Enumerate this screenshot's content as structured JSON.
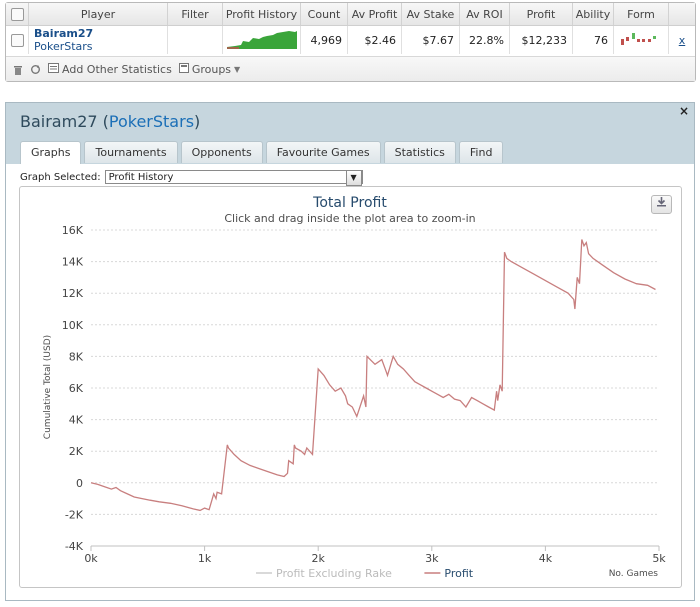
{
  "stats_table": {
    "headers": [
      "Player",
      "Filter",
      "Profit History",
      "Count",
      "Av Profit",
      "Av Stake",
      "Av ROI",
      "Profit",
      "Ability",
      "Form"
    ],
    "row": {
      "player_name": "Bairam27",
      "site": "PokerStars",
      "filter": "",
      "count": "4,969",
      "av_profit": "$2.46",
      "av_stake": "$7.67",
      "av_roi": "22.8%",
      "profit": "$12,233",
      "ability": "76",
      "remove": "x"
    },
    "toolbar": {
      "add_stats_label": "Add Other Statistics",
      "groups_label": "Groups"
    }
  },
  "panel": {
    "player_name": "Bairam27",
    "site": "PokerStars",
    "tabs": [
      "Graphs",
      "Tournaments",
      "Opponents",
      "Favourite Games",
      "Statistics",
      "Find"
    ],
    "active_tab": "Graphs",
    "graph_selected_label": "Graph Selected:",
    "graph_selected_value": "Profit History",
    "close_label": "×"
  },
  "chart_data": {
    "type": "line",
    "title": "Total Profit",
    "subtitle": "Click and drag inside the plot area to zoom-in",
    "ylabel": "Cumulative Total (USD)",
    "xlabel": "No. Games",
    "ylim": [
      -4000,
      16000
    ],
    "xlim": [
      0,
      5000
    ],
    "yticks": [
      "-4K",
      "-2K",
      "0",
      "2K",
      "4K",
      "6K",
      "8K",
      "10K",
      "12K",
      "14K",
      "16K"
    ],
    "xticks": [
      "0k",
      "1k",
      "2k",
      "3k",
      "4k",
      "5k"
    ],
    "grid": true,
    "legend_position": "bottom-center",
    "series": [
      {
        "name": "Profit Excluding Rake",
        "color": "#cccccc",
        "values": []
      },
      {
        "name": "Profit",
        "color": "#c87f7f",
        "x": [
          0,
          60,
          120,
          180,
          220,
          260,
          320,
          380,
          450,
          520,
          600,
          700,
          800,
          900,
          960,
          1000,
          1040,
          1080,
          1100,
          1110,
          1150,
          1200,
          1210,
          1260,
          1320,
          1400,
          1480,
          1560,
          1640,
          1700,
          1730,
          1740,
          1780,
          1790,
          1800,
          1850,
          1880,
          1900,
          1950,
          2000,
          2050,
          2100,
          2150,
          2200,
          2240,
          2260,
          2300,
          2340,
          2400,
          2420,
          2430,
          2500,
          2560,
          2600,
          2610,
          2660,
          2700,
          2750,
          2800,
          2850,
          2900,
          2950,
          3000,
          3050,
          3100,
          3150,
          3200,
          3250,
          3300,
          3350,
          3400,
          3450,
          3500,
          3550,
          3570,
          3580,
          3600,
          3620,
          3640,
          3660,
          3700,
          3800,
          3900,
          4000,
          4100,
          4200,
          4250,
          4260,
          4280,
          4300,
          4320,
          4340,
          4360,
          4380,
          4420,
          4500,
          4600,
          4700,
          4800,
          4900,
          4969
        ],
        "values": [
          0,
          -100,
          -250,
          -400,
          -300,
          -500,
          -700,
          -900,
          -1000,
          -1100,
          -1200,
          -1300,
          -1450,
          -1650,
          -1750,
          -1600,
          -1700,
          -700,
          -1000,
          -600,
          -700,
          2400,
          2200,
          1800,
          1400,
          1100,
          900,
          700,
          500,
          400,
          600,
          1400,
          1200,
          2400,
          2200,
          2000,
          1800,
          2200,
          1800,
          7200,
          6800,
          6200,
          5800,
          6000,
          5500,
          5000,
          4800,
          4200,
          5500,
          4800,
          8000,
          7500,
          7800,
          7000,
          6800,
          8000,
          7500,
          7200,
          6800,
          6400,
          6200,
          6000,
          5800,
          5600,
          5400,
          5600,
          5300,
          5200,
          4800,
          5400,
          5200,
          5000,
          4800,
          4600,
          5800,
          5200,
          6200,
          5800,
          14600,
          14200,
          14000,
          13600,
          13200,
          12800,
          12400,
          12000,
          11600,
          11000,
          13000,
          12600,
          15400,
          15000,
          15200,
          14500,
          14200,
          13800,
          13300,
          12900,
          12600,
          12500,
          12233
        ]
      }
    ]
  },
  "colors": {
    "accent": "#1a4f8a",
    "panel_header": "#c6d6de",
    "profit_line": "#c87f7f",
    "sparkline_green": "#3aa53a",
    "form_red": "#c0504d",
    "form_green": "#5cb85c"
  }
}
